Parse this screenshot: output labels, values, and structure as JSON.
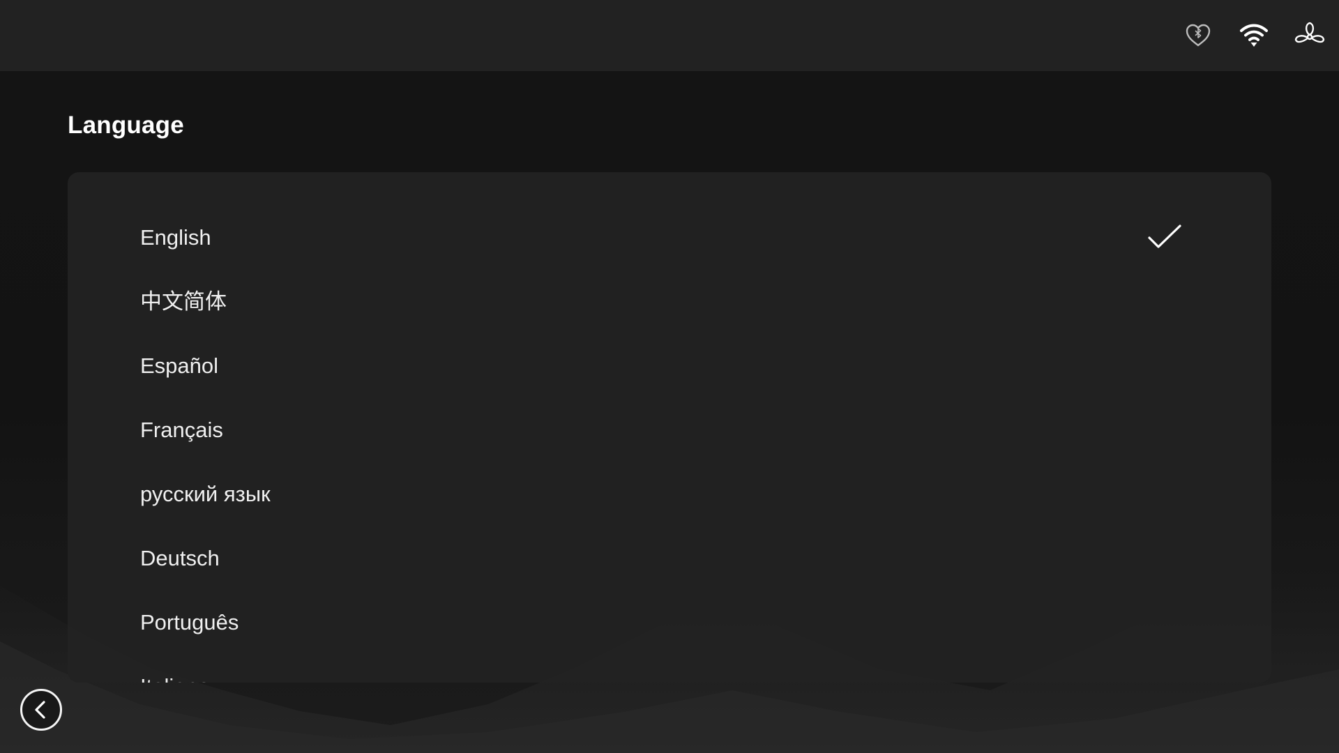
{
  "header": {
    "icons": [
      "heart-bluetooth-icon",
      "wifi-icon",
      "fan-icon"
    ]
  },
  "page": {
    "title": "Language"
  },
  "languages": {
    "selected": "English",
    "items": [
      {
        "label": "English",
        "selected": true
      },
      {
        "label": "中文简体",
        "selected": false
      },
      {
        "label": "Español",
        "selected": false
      },
      {
        "label": "Français",
        "selected": false
      },
      {
        "label": "русский язык",
        "selected": false
      },
      {
        "label": "Deutsch",
        "selected": false
      },
      {
        "label": "Português",
        "selected": false
      },
      {
        "label": "Italiano",
        "selected": false
      }
    ]
  },
  "navigation": {
    "back_icon": "chevron-left-icon"
  },
  "colors": {
    "background": "#121212",
    "topbar": "#222222",
    "panel": "#222222",
    "text": "#f0f0f0"
  }
}
